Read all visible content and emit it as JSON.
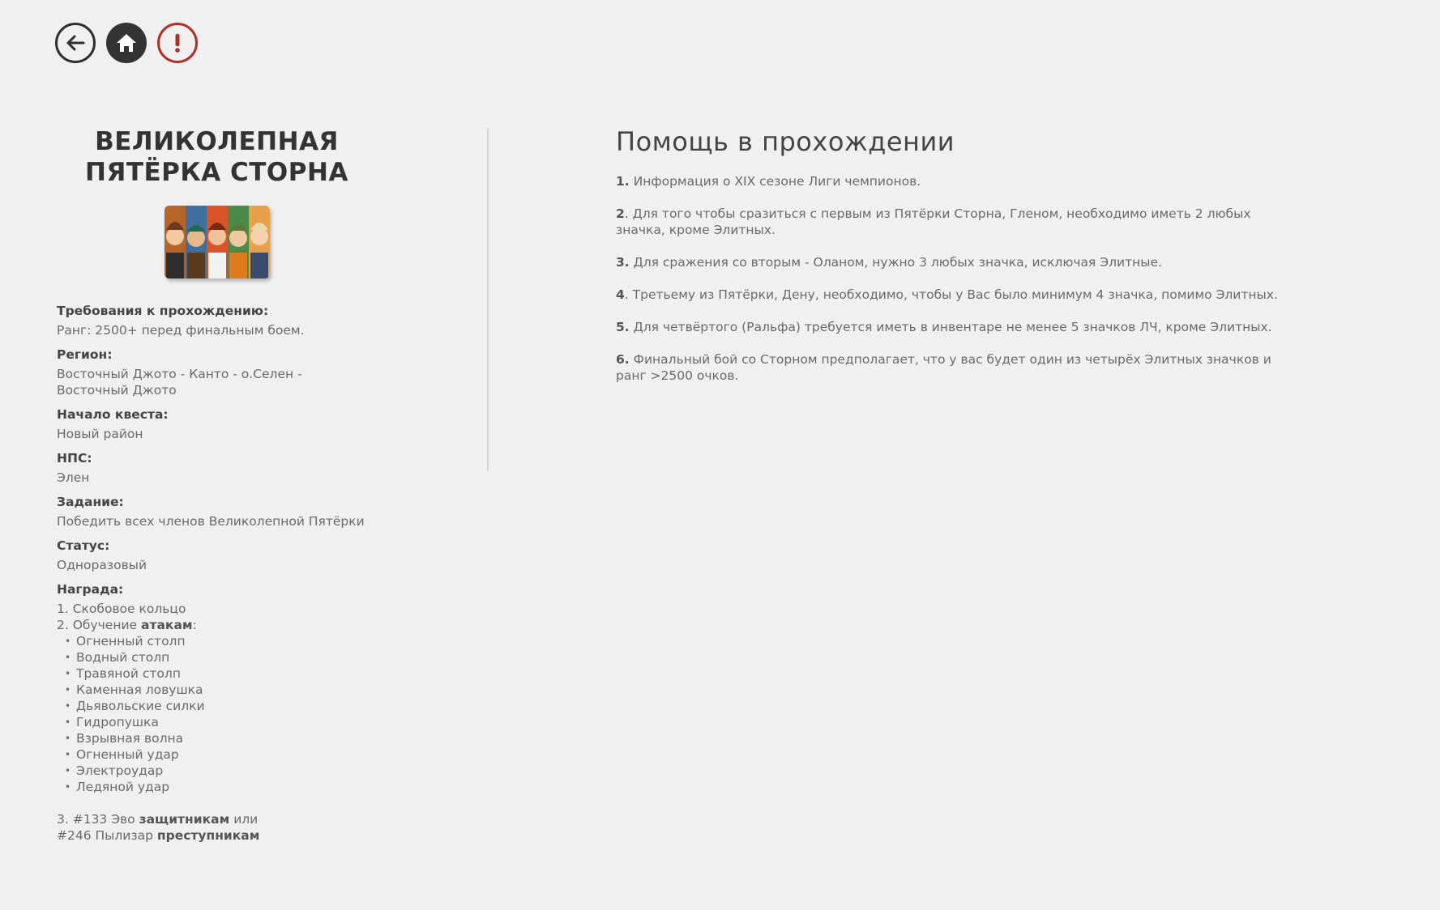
{
  "nav": {
    "back_icon": "back-arrow-icon",
    "home_icon": "home-icon",
    "report_icon": "exclamation-icon",
    "colors": {
      "dark": "#333333",
      "report": "#b03028"
    }
  },
  "quest": {
    "title_line1": "ВЕЛИКОЛЕПНАЯ",
    "title_line2": "ПЯТЁРКА СТОРНА",
    "image_alt": "group-portrait-image"
  },
  "info": {
    "requirements_label": "Требования к прохождению:",
    "requirements_value": "Ранг: 2500+ перед финальным боем.",
    "region_label": "Регион:",
    "region_value_line1": "Восточный Джото - Канто - о.Селен -",
    "region_value_line2": "Восточный Джото",
    "start_label": "Начало квеста:",
    "start_value": "Новый район",
    "npc_label": "НПС:",
    "npc_value": "Элен",
    "task_label": "Задание:",
    "task_value": "Победить всех членов Великолепной Пятёрки",
    "status_label": "Статус:",
    "status_value": "Одноразовый",
    "reward_label": "Награда:",
    "reward_1": "1.  Скобовое кольцо",
    "reward_2_prefix": "2. Обучение ",
    "reward_2_bold": "атакам",
    "reward_2_suffix": ":",
    "moves": [
      "Огненный столп",
      "Водный столп",
      "Травяной столп",
      "Каменная ловушка",
      "Дьявольские силки",
      "Гидропушка",
      "Взрывная волна",
      "Огненный удар",
      "Электроудар",
      "Ледяной удар"
    ],
    "reward_3_prefix": "3. #133 Эво ",
    "reward_3_bold": "защитникам",
    "reward_3_suffix": " или",
    "reward_3b_prefix": "#246 Пылизар ",
    "reward_3b_bold": "преступникам"
  },
  "help": {
    "title": "Помощь в прохождении",
    "tips": [
      {
        "num": "1.",
        "text": " Информация о XIX сезоне Лиги чемпионов."
      },
      {
        "num": "2",
        "text": ". Для того чтобы сразиться с первым из Пятёрки Сторна, Гленом, необходимо иметь 2 любых значка, кроме Элитных."
      },
      {
        "num": "3.",
        "text": " Для сражения со вторым - Оланом, нужно 3 любых значка, исключая Элитные."
      },
      {
        "num": "4",
        "text": ". Третьему из Пятёрки, Дену, необходимо, чтобы у Вас было минимум 4 значка, помимо Элитных."
      },
      {
        "num": "5.",
        "text": " Для четвёртого (Ральфа) требуется иметь в инвентаре не менее 5 значков ЛЧ, кроме Элитных."
      },
      {
        "num": "6.",
        "text": " Финальный бой со Сторном предполагает, что у вас будет один из четырёх Элитных значков и ранг >2500 очков."
      }
    ]
  }
}
